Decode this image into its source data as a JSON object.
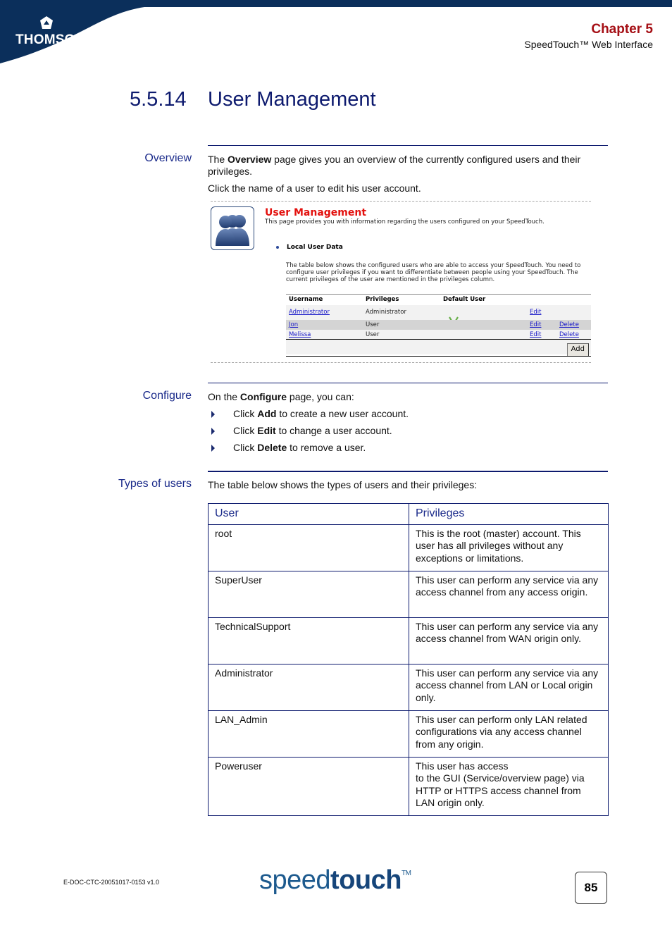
{
  "header": {
    "brand": "THOMSON",
    "chapter": "Chapter 5",
    "chapter_subtitle": "SpeedTouch™ Web Interface",
    "colors": {
      "banner": "#0b2f5b",
      "chapter": "#a50f15",
      "accent": "#0d1a6e"
    }
  },
  "title": {
    "number": "5.5.14",
    "text": "User Management"
  },
  "overview": {
    "label": "Overview",
    "p1_pre": "The ",
    "p1_bold": "Overview",
    "p1_post": " page gives you an overview of the currently configured users and their privileges.",
    "p2": "Click the name of a user to edit his user account."
  },
  "screenshot": {
    "icon": "users-icon",
    "title": "User Management",
    "description": "This page provides you with information regarding the users configured on your SpeedTouch.",
    "section_title": "Local User Data",
    "section_desc": "The table below shows the configured users who are able to access your SpeedTouch. You need to configure user privileges if you want to differentiate between people using your SpeedTouch. The current privileges of the user are mentioned in the privileges column.",
    "table": {
      "headers": [
        "Username",
        "Privileges",
        "Default User"
      ],
      "rows": [
        {
          "username": "Administrator",
          "privileges": "Administrator",
          "default": true,
          "edit": "Edit",
          "delete": ""
        },
        {
          "username": "Jon",
          "privileges": "User",
          "default": false,
          "edit": "Edit",
          "delete": "Delete"
        },
        {
          "username": "Melissa",
          "privileges": "User",
          "default": false,
          "edit": "Edit",
          "delete": "Delete"
        }
      ],
      "add_label": "Add"
    }
  },
  "configure": {
    "label": "Configure",
    "intro_pre": "On the ",
    "intro_bold": "Configure",
    "intro_post": " page, you can:",
    "bullets": [
      {
        "pre": "Click ",
        "bold": "Add",
        "post": " to create a new user account."
      },
      {
        "pre": "Click ",
        "bold": "Edit",
        "post": " to change a user account."
      },
      {
        "pre": "Click ",
        "bold": "Delete",
        "post": " to remove a user."
      }
    ]
  },
  "types": {
    "label": "Types of users",
    "intro": "The table below shows the types of users and their privileges:",
    "headers": [
      "User",
      "Privileges"
    ],
    "rows": [
      {
        "user": "root",
        "privileges": "This is the root (master) account. This user has all privileges without any exceptions or limitations."
      },
      {
        "user": "SuperUser",
        "privileges": "This user can perform any service via any access channel from any access origin."
      },
      {
        "user": "TechnicalSupport",
        "privileges": "This user can perform any service via any access channel from WAN origin only."
      },
      {
        "user": "Administrator",
        "privileges": "This user can perform any service via any access channel from LAN or Local origin only."
      },
      {
        "user": "LAN_Admin",
        "privileges": "This user can perform only LAN related configurations via any access channel from any origin."
      },
      {
        "user": "Poweruser",
        "privileges": "This user has access\nto the GUI (Service/overview page) via HTTP or HTTPS access channel from LAN origin only."
      }
    ]
  },
  "footer": {
    "doc_id": "E-DOC-CTC-20051017-0153 v1.0",
    "logo_light": "speed",
    "logo_bold": "touch",
    "logo_tm": "TM",
    "page_number": "85"
  }
}
